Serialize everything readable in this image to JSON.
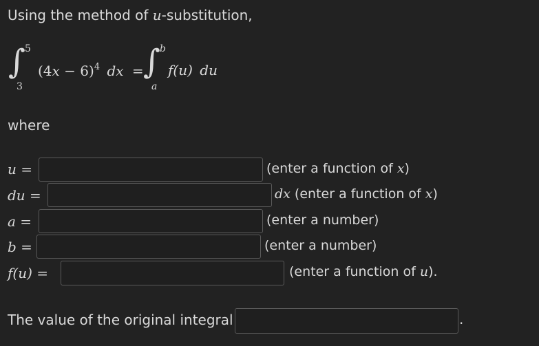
{
  "intro": {
    "prefix": "Using the method of ",
    "var": "u",
    "suffix": "-substitution,"
  },
  "equation": {
    "left_upper": "5",
    "left_lower": "3",
    "integrand": "(4x − 6)",
    "integrand_parts": {
      "open": "(4",
      "x": "x",
      "rest": " − 6)",
      "power": "4",
      "dx": "dx",
      "equals": "="
    },
    "right_upper": "b",
    "right_lower": "a",
    "right_integrand": {
      "f": "f",
      "u": "(u)",
      "du": "du"
    }
  },
  "where_label": "where",
  "rows": [
    {
      "label_var": "u",
      "label_eq": " =",
      "value": "",
      "hint_pre": "(enter a function of ",
      "hint_var": "x",
      "hint_post": ")"
    },
    {
      "label_var": "du",
      "label_eq": " =",
      "value": "",
      "hint_pre": " (enter a function of ",
      "hint_lead": "dx",
      "hint_var": "x",
      "hint_post": ")"
    },
    {
      "label_var": "a",
      "label_eq": " =",
      "value": "",
      "hint_pre": "(enter a number)"
    },
    {
      "label_var": "b",
      "label_eq": " =",
      "value": "",
      "hint_pre": "(enter a number)"
    },
    {
      "label_var": "f",
      "label_arg": "(u)",
      "label_eq": " =",
      "value": "",
      "hint_pre": "(enter a function of ",
      "hint_var": "u",
      "hint_post": ")."
    }
  ],
  "final": {
    "label": "The value of the original integral is",
    "value": "",
    "period": "."
  }
}
